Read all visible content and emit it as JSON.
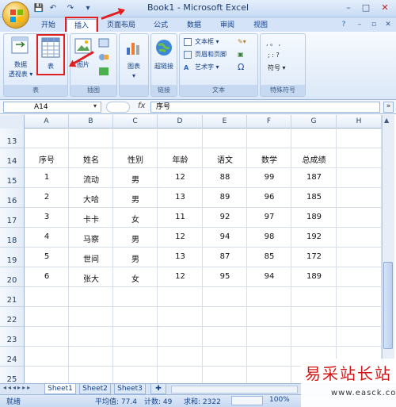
{
  "window": {
    "title": "Book1 - Microsoft Excel",
    "controls": {
      "minimize": "–",
      "maximize": "□",
      "close": "✕"
    }
  },
  "qat": {
    "save": "💾",
    "undo": "↶",
    "redo": "↷",
    "preview": "▾"
  },
  "ribbon_tabs": [
    "开始",
    "插入",
    "页面布局",
    "公式",
    "数据",
    "审阅",
    "视图"
  ],
  "ribbon_right": {
    "help": "?",
    "min": "–",
    "restore": "▫",
    "close": "✕"
  },
  "ribbon": {
    "groups": {
      "tables": {
        "label": "表",
        "pivot_label_1": "数据",
        "pivot_label_2": "透视表 ▾",
        "table_label": "表"
      },
      "illustrations": {
        "label": "插图",
        "picture_label": "图片"
      },
      "charts": {
        "label": "",
        "chart_label": "图表",
        "chart_arrow": "▾"
      },
      "links": {
        "label": "链接",
        "hyperlink_label": "超链接"
      },
      "text": {
        "label": "文本",
        "textbox": "文本框 ▾",
        "header_footer": "页眉和页脚",
        "wordart": "艺术字 ▾",
        "omega": "Ω"
      },
      "symbols": {
        "label": "特殊符号",
        "row1": ",  。  ,",
        "row2": ";  :  ?",
        "symbol_btn": "符号 ▾"
      }
    }
  },
  "formula_bar": {
    "name_box": "A14",
    "fx": "fx",
    "content": "序号"
  },
  "columns": [
    "A",
    "B",
    "C",
    "D",
    "E",
    "F",
    "G",
    "H"
  ],
  "rows": [
    "13",
    "14",
    "15",
    "16",
    "17",
    "18",
    "19",
    "20",
    "21",
    "22",
    "23",
    "24",
    "25"
  ],
  "table": {
    "headers": [
      "序号",
      "姓名",
      "性别",
      "年龄",
      "语文",
      "数学",
      "总成绩"
    ],
    "data": [
      [
        "1",
        "流动",
        "男",
        "12",
        "88",
        "99",
        "187"
      ],
      [
        "2",
        "大哈",
        "男",
        "13",
        "89",
        "96",
        "185"
      ],
      [
        "3",
        "卡卡",
        "女",
        "11",
        "92",
        "97",
        "189"
      ],
      [
        "4",
        "马察",
        "男",
        "12",
        "94",
        "98",
        "192"
      ],
      [
        "5",
        "世间",
        "男",
        "13",
        "87",
        "85",
        "172"
      ],
      [
        "6",
        "张大",
        "女",
        "12",
        "95",
        "94",
        "189"
      ]
    ]
  },
  "sheets": [
    "Sheet1",
    "Sheet2",
    "Sheet3"
  ],
  "status": {
    "mode": "就绪",
    "average": "平均值: 77.4",
    "count": "计数: 49",
    "sum": "求和: 2322",
    "zoom": "100%"
  },
  "watermark": {
    "main": "易采站长站",
    "sub": "www.easck.com"
  },
  "colors": {
    "highlight": "#e02020",
    "ribbon": "#dbe8f8",
    "watermark": "#d31515"
  }
}
